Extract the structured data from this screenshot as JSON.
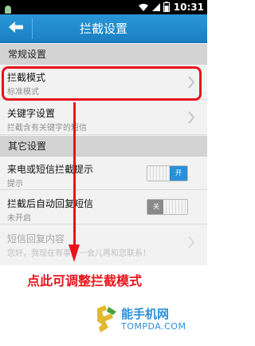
{
  "status_bar": {
    "time": "10:31"
  },
  "header": {
    "title": "拦截设置"
  },
  "sections": [
    {
      "title": "常规设置"
    },
    {
      "title": "其它设置"
    }
  ],
  "rows": {
    "block_mode": {
      "title": "拦截模式",
      "subtitle": "标准模式"
    },
    "keyword": {
      "title": "关键字设置",
      "subtitle": "拦截含有关键字的短信"
    },
    "notify": {
      "title": "来电或短信拦截提示",
      "subtitle": "提示",
      "toggle_label": "开",
      "enabled": true
    },
    "auto_reply": {
      "title": "拦截后自动回复短信",
      "subtitle": "未开启",
      "toggle_label": "关",
      "enabled": false
    },
    "reply_content": {
      "title": "短信回复内容",
      "subtitle": "您好，我现在有事，一会儿再和您联系！"
    }
  },
  "annotation": {
    "caption": "点此可调整拦截模式"
  },
  "watermark": {
    "name": "能手机网",
    "url": "TOMPDA.COM"
  },
  "colors": {
    "accent": "#1f8ad0",
    "annotation": "#e8141c"
  }
}
